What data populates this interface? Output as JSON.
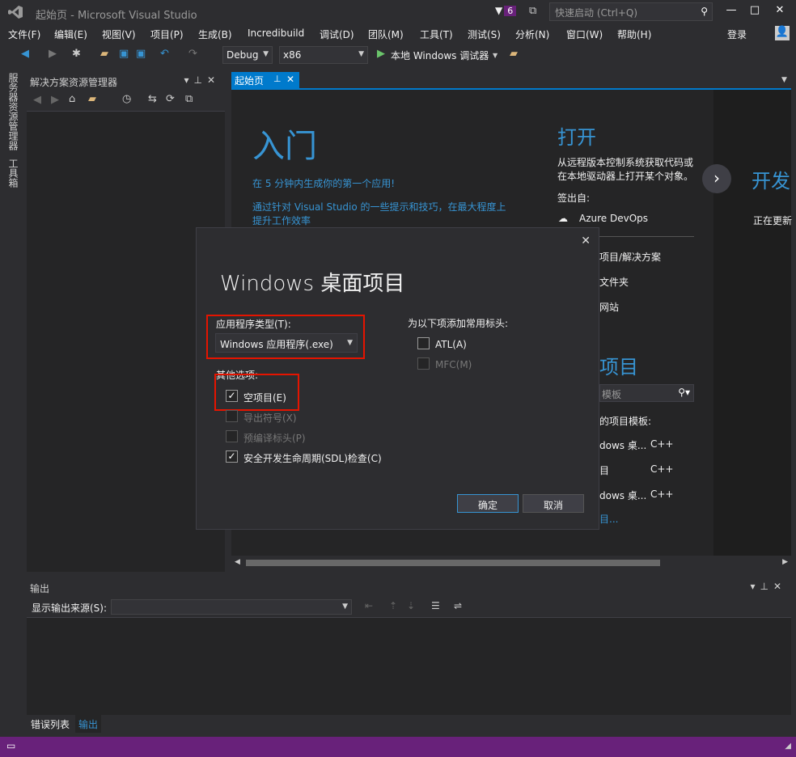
{
  "title_bar": {
    "title": "起始页 - Microsoft Visual Studio",
    "notif_count": "6",
    "quick_launch_placeholder": "快速启动 (Ctrl+Q)"
  },
  "menu": {
    "items": [
      "文件(F)",
      "编辑(E)",
      "视图(V)",
      "项目(P)",
      "生成(B)",
      "Incredibuild",
      "调试(D)",
      "团队(M)",
      "工具(T)",
      "测试(S)",
      "分析(N)",
      "窗口(W)",
      "帮助(H)"
    ],
    "login": "登录"
  },
  "toolbar": {
    "config": "Debug",
    "platform": "x86",
    "run_label": "本地 Windows 调试器"
  },
  "side_tabs": {
    "server_explorer": "服务器资源管理器",
    "toolbox": "工具箱"
  },
  "solution_explorer": {
    "title": "解决方案资源管理器"
  },
  "doc_tab": {
    "label": "起始页"
  },
  "start_page": {
    "heading": "入门",
    "link1": "在 5 分钟内生成你的第一个应用!",
    "link2_line1": "通过针对 Visual Studio 的一些提示和技巧，在最大程度上",
    "link2_line2": "提升工作效率",
    "open_heading": "打开",
    "open_desc_line1": "从远程版本控制系统获取代码或",
    "open_desc_line2": "在本地驱动器上打开某个对象。",
    "checkout_label": "签出自:",
    "azure": "Azure DevOps",
    "open_item1": "项目/解决方案",
    "open_item2": "文件夹",
    "open_item3": "网站",
    "new_heading": "项目",
    "search_placeholder": "模板",
    "recent_label": "的项目模板:",
    "tpl1_name": "dows 桌...",
    "tpl1_lang": "C++",
    "tpl2_name": "目",
    "tpl2_lang": "C++",
    "tpl3_name": "dows 桌...",
    "tpl3_lang": "C++",
    "more": "目...",
    "dev_heading": "开发",
    "dev_status": "正在更新"
  },
  "dialog": {
    "title": "Windows 桌面项目",
    "app_type_label": "应用程序类型(T):",
    "app_type_value": "Windows 应用程序(.exe)",
    "other_label": "其他选项:",
    "opt_empty": "空项目(E)",
    "opt_export": "导出符号(X)",
    "opt_pch": "预编译标头(P)",
    "opt_sdl": "安全开发生命周期(SDL)检查(C)",
    "headers_label": "为以下项添加常用标头:",
    "atl": "ATL(A)",
    "mfc": "MFC(M)",
    "ok": "确定",
    "cancel": "取消",
    "checked": {
      "empty": true,
      "export": false,
      "pch": false,
      "sdl": true,
      "atl": false,
      "mfc": false
    }
  },
  "output": {
    "title": "输出",
    "source_label": "显示输出来源(S):"
  },
  "bottom_tabs": {
    "errors": "错误列表",
    "output": "输出"
  },
  "colors": {
    "accent": "#007acc",
    "status": "#68217a",
    "link": "#3794d3",
    "highlight": "#e51400"
  }
}
